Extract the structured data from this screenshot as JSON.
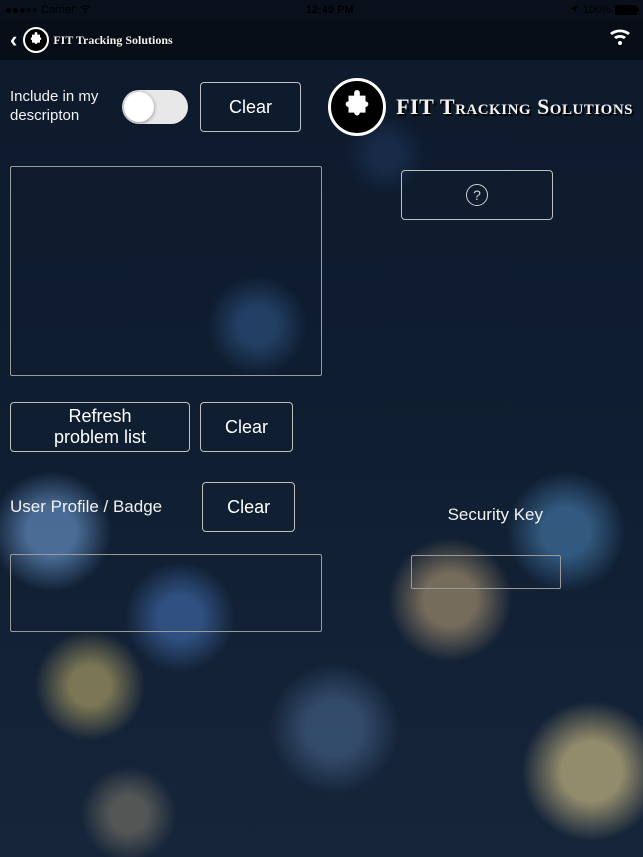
{
  "status_bar": {
    "carrier": "Carrier",
    "time": "12:49 PM",
    "battery_pct": "100%"
  },
  "header": {
    "brand_small": "FIT Tracking Solutions"
  },
  "brand": {
    "line1": "FIT",
    "line2": "Tracking Solutions"
  },
  "controls": {
    "include_label": "Include in my descripton",
    "clear_1": "Clear",
    "refresh_problem_list": "Refresh problem list",
    "clear_2": "Clear",
    "user_profile_label": "User Profile / Badge",
    "clear_3": "Clear",
    "security_key_label": "Security Key",
    "help_symbol": "?"
  },
  "toggle": {
    "include_in_description": false
  },
  "fields": {
    "description_text": "",
    "profile_badge": "",
    "security_key": ""
  }
}
